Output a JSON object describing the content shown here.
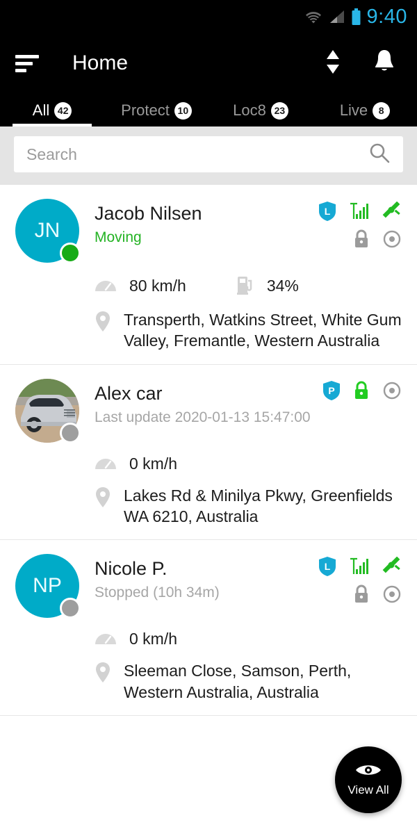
{
  "statusbar": {
    "time": "9:40",
    "wifi_icon": "wifi-icon",
    "cellular_icon": "cellular-signal-icon",
    "battery_icon": "battery-icon",
    "time_color": "#29b6e8",
    "battery_color": "#29b6e8"
  },
  "appbar": {
    "title": "Home",
    "menu_icon": "filter-sort-icon",
    "sort_icon": "sort-updown-icon",
    "notification_icon": "bell-icon"
  },
  "tabs": [
    {
      "label": "All",
      "badge": "42",
      "active": true
    },
    {
      "label": "Protect",
      "badge": "10",
      "active": false
    },
    {
      "label": "Loc8",
      "badge": "23",
      "active": false
    },
    {
      "label": "Live",
      "badge": "8",
      "active": false
    }
  ],
  "search": {
    "placeholder": "Search",
    "value": "",
    "icon": "search-icon"
  },
  "items": [
    {
      "avatar_initials": "JN",
      "avatar_type": "initials",
      "status_dot": "online",
      "name": "Jacob Nilsen",
      "substatus": "Moving",
      "substatus_style": "moving",
      "shield_letter": "L",
      "signal_icon": "signal-bars-icon",
      "satellite_icon": "satellite-icon",
      "lock_icon": "lock-icon",
      "lock_state": "grey",
      "target_icon": "target-icon",
      "speed": "80 km/h",
      "speed_icon": "speedometer-icon",
      "fuel": "34%",
      "fuel_icon": "fuel-pump-icon",
      "address": "Transperth, Watkins Street, White Gum Valley, Fremantle, Western Australia",
      "address_icon": "map-pin-icon"
    },
    {
      "avatar_initials": "",
      "avatar_type": "photo",
      "status_dot": "offline",
      "name": "Alex car",
      "substatus": "Last update 2020-01-13 15:47:00",
      "substatus_style": "idle",
      "shield_letter": "P",
      "signal_icon": "",
      "satellite_icon": "",
      "lock_icon": "lock-icon",
      "lock_state": "green",
      "target_icon": "target-icon",
      "speed": "0 km/h",
      "speed_icon": "speedometer-icon",
      "fuel": "",
      "fuel_icon": "",
      "address": "Lakes Rd & Minilya Pkwy, Greenfields WA 6210, Australia",
      "address_icon": "map-pin-icon"
    },
    {
      "avatar_initials": "NP",
      "avatar_type": "initials",
      "status_dot": "offline",
      "name": "Nicole P.",
      "substatus": "Stopped (10h 34m)",
      "substatus_style": "idle",
      "shield_letter": "L",
      "signal_icon": "signal-bars-icon",
      "satellite_icon": "satellite-icon",
      "lock_icon": "lock-icon",
      "lock_state": "grey",
      "target_icon": "target-icon",
      "speed": "0 km/h",
      "speed_icon": "speedometer-icon",
      "fuel": "",
      "fuel_icon": "",
      "address": "Sleeman Close, Samson, Perth, Western Australia, Australia",
      "address_icon": "map-pin-icon"
    }
  ],
  "fab": {
    "label": "View All",
    "icon": "eye-icon"
  },
  "colors": {
    "accent_teal": "#00abc8",
    "status_green": "#24b324",
    "lock_green": "#22cc22",
    "shield_blue": "#16a9d4",
    "appbar_black": "#000000",
    "search_bg": "#e4e4e4",
    "muted_grey": "#a6a6a6"
  }
}
